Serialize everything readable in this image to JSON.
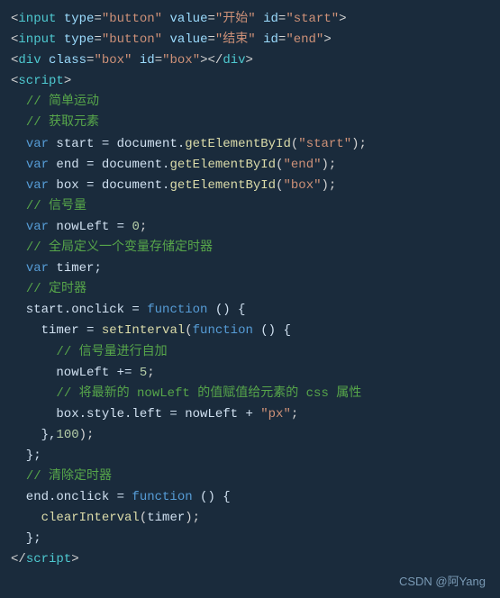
{
  "code": {
    "lines": [
      {
        "id": 1,
        "tokens": [
          {
            "cls": "punct",
            "text": "<"
          },
          {
            "cls": "tag",
            "text": "input"
          },
          {
            "cls": "white",
            "text": " "
          },
          {
            "cls": "attr",
            "text": "type"
          },
          {
            "cls": "punct",
            "text": "="
          },
          {
            "cls": "val",
            "text": "\"button\""
          },
          {
            "cls": "white",
            "text": " "
          },
          {
            "cls": "attr",
            "text": "value"
          },
          {
            "cls": "punct",
            "text": "="
          },
          {
            "cls": "val",
            "text": "\"开始\""
          },
          {
            "cls": "white",
            "text": " "
          },
          {
            "cls": "attr",
            "text": "id"
          },
          {
            "cls": "punct",
            "text": "="
          },
          {
            "cls": "val",
            "text": "\"start\""
          },
          {
            "cls": "punct",
            "text": ">"
          }
        ]
      },
      {
        "id": 2,
        "tokens": [
          {
            "cls": "punct",
            "text": "<"
          },
          {
            "cls": "tag",
            "text": "input"
          },
          {
            "cls": "white",
            "text": " "
          },
          {
            "cls": "attr",
            "text": "type"
          },
          {
            "cls": "punct",
            "text": "="
          },
          {
            "cls": "val",
            "text": "\"button\""
          },
          {
            "cls": "white",
            "text": " "
          },
          {
            "cls": "attr",
            "text": "value"
          },
          {
            "cls": "punct",
            "text": "="
          },
          {
            "cls": "val",
            "text": "\"结束\""
          },
          {
            "cls": "white",
            "text": " "
          },
          {
            "cls": "attr",
            "text": "id"
          },
          {
            "cls": "punct",
            "text": "="
          },
          {
            "cls": "val",
            "text": "\"end\""
          },
          {
            "cls": "punct",
            "text": ">"
          }
        ]
      },
      {
        "id": 3,
        "tokens": [
          {
            "cls": "punct",
            "text": "<"
          },
          {
            "cls": "tag",
            "text": "div"
          },
          {
            "cls": "white",
            "text": " "
          },
          {
            "cls": "attr",
            "text": "class"
          },
          {
            "cls": "punct",
            "text": "="
          },
          {
            "cls": "val",
            "text": "\"box\""
          },
          {
            "cls": "white",
            "text": " "
          },
          {
            "cls": "attr",
            "text": "id"
          },
          {
            "cls": "punct",
            "text": "="
          },
          {
            "cls": "val",
            "text": "\"box\""
          },
          {
            "cls": "punct",
            "text": "></"
          },
          {
            "cls": "tag",
            "text": "div"
          },
          {
            "cls": "punct",
            "text": ">"
          }
        ]
      },
      {
        "id": 4,
        "tokens": [
          {
            "cls": "punct",
            "text": "<"
          },
          {
            "cls": "tag",
            "text": "script"
          },
          {
            "cls": "punct",
            "text": ">"
          }
        ]
      },
      {
        "id": 5,
        "tokens": [
          {
            "cls": "white",
            "text": "  "
          },
          {
            "cls": "comment",
            "text": "// 简单运动"
          }
        ]
      },
      {
        "id": 6,
        "tokens": [
          {
            "cls": "white",
            "text": "  "
          },
          {
            "cls": "comment",
            "text": "// 获取元素"
          }
        ]
      },
      {
        "id": 7,
        "tokens": [
          {
            "cls": "white",
            "text": "  "
          },
          {
            "cls": "keyword",
            "text": "var"
          },
          {
            "cls": "white",
            "text": " start = document."
          },
          {
            "cls": "func",
            "text": "getElementById"
          },
          {
            "cls": "punct",
            "text": "("
          },
          {
            "cls": "val",
            "text": "\"start\""
          },
          {
            "cls": "punct",
            "text": ");"
          }
        ]
      },
      {
        "id": 8,
        "tokens": [
          {
            "cls": "white",
            "text": "  "
          },
          {
            "cls": "keyword",
            "text": "var"
          },
          {
            "cls": "white",
            "text": " end = document."
          },
          {
            "cls": "func",
            "text": "getElementById"
          },
          {
            "cls": "punct",
            "text": "("
          },
          {
            "cls": "val",
            "text": "\"end\""
          },
          {
            "cls": "punct",
            "text": ");"
          }
        ]
      },
      {
        "id": 9,
        "tokens": [
          {
            "cls": "white",
            "text": "  "
          },
          {
            "cls": "keyword",
            "text": "var"
          },
          {
            "cls": "white",
            "text": " box = document."
          },
          {
            "cls": "func",
            "text": "getElementById"
          },
          {
            "cls": "punct",
            "text": "("
          },
          {
            "cls": "val",
            "text": "\"box\""
          },
          {
            "cls": "punct",
            "text": ");"
          }
        ]
      },
      {
        "id": 10,
        "tokens": [
          {
            "cls": "white",
            "text": "  "
          },
          {
            "cls": "comment",
            "text": "// 信号量"
          }
        ]
      },
      {
        "id": 11,
        "tokens": [
          {
            "cls": "white",
            "text": "  "
          },
          {
            "cls": "keyword",
            "text": "var"
          },
          {
            "cls": "white",
            "text": " nowLeft = "
          },
          {
            "cls": "number",
            "text": "0"
          },
          {
            "cls": "punct",
            "text": ";"
          }
        ]
      },
      {
        "id": 12,
        "tokens": [
          {
            "cls": "white",
            "text": "  "
          },
          {
            "cls": "comment",
            "text": "// 全局定义一个变量存储定时器"
          }
        ]
      },
      {
        "id": 13,
        "tokens": [
          {
            "cls": "white",
            "text": "  "
          },
          {
            "cls": "keyword",
            "text": "var"
          },
          {
            "cls": "white",
            "text": " timer;"
          }
        ]
      },
      {
        "id": 14,
        "tokens": [
          {
            "cls": "white",
            "text": "  "
          },
          {
            "cls": "comment",
            "text": "// 定时器"
          }
        ]
      },
      {
        "id": 15,
        "tokens": [
          {
            "cls": "white",
            "text": "  start.onclick = "
          },
          {
            "cls": "keyword",
            "text": "function"
          },
          {
            "cls": "white",
            "text": " () {"
          }
        ]
      },
      {
        "id": 16,
        "tokens": [
          {
            "cls": "white",
            "text": "    timer = "
          },
          {
            "cls": "func",
            "text": "setInterval"
          },
          {
            "cls": "punct",
            "text": "("
          },
          {
            "cls": "keyword",
            "text": "function"
          },
          {
            "cls": "white",
            "text": " () {"
          }
        ]
      },
      {
        "id": 17,
        "tokens": [
          {
            "cls": "white",
            "text": "      "
          },
          {
            "cls": "comment",
            "text": "// 信号量进行自加"
          }
        ]
      },
      {
        "id": 18,
        "tokens": [
          {
            "cls": "white",
            "text": "      nowLeft += "
          },
          {
            "cls": "number",
            "text": "5"
          },
          {
            "cls": "punct",
            "text": ";"
          }
        ]
      },
      {
        "id": 19,
        "tokens": [
          {
            "cls": "white",
            "text": "      "
          },
          {
            "cls": "comment",
            "text": "// 将最新的 nowLeft 的值赋值给元素的 css 属性"
          }
        ]
      },
      {
        "id": 20,
        "tokens": [
          {
            "cls": "white",
            "text": "      box.style.left = nowLeft + "
          },
          {
            "cls": "val",
            "text": "\"px\""
          },
          {
            "cls": "punct",
            "text": ";"
          }
        ]
      },
      {
        "id": 21,
        "tokens": [
          {
            "cls": "white",
            "text": "    },"
          },
          {
            "cls": "number",
            "text": "100"
          },
          {
            "cls": "punct",
            "text": ");"
          }
        ]
      },
      {
        "id": 22,
        "tokens": [
          {
            "cls": "white",
            "text": "  };"
          }
        ]
      },
      {
        "id": 23,
        "tokens": [
          {
            "cls": "white",
            "text": "  "
          },
          {
            "cls": "comment",
            "text": "// 清除定时器"
          }
        ]
      },
      {
        "id": 24,
        "tokens": [
          {
            "cls": "white",
            "text": "  end.onclick = "
          },
          {
            "cls": "keyword",
            "text": "function"
          },
          {
            "cls": "white",
            "text": " () {"
          }
        ]
      },
      {
        "id": 25,
        "tokens": [
          {
            "cls": "white",
            "text": "    "
          },
          {
            "cls": "func",
            "text": "clearInterval"
          },
          {
            "cls": "punct",
            "text": "("
          },
          {
            "cls": "white",
            "text": "timer"
          },
          {
            "cls": "punct",
            "text": ");"
          }
        ]
      },
      {
        "id": 26,
        "tokens": [
          {
            "cls": "white",
            "text": "  };"
          }
        ]
      },
      {
        "id": 27,
        "tokens": [
          {
            "cls": "punct",
            "text": "</"
          },
          {
            "cls": "tag",
            "text": "script"
          },
          {
            "cls": "punct",
            "text": ">"
          }
        ]
      }
    ],
    "watermark": "CSDN @阿Yang"
  }
}
